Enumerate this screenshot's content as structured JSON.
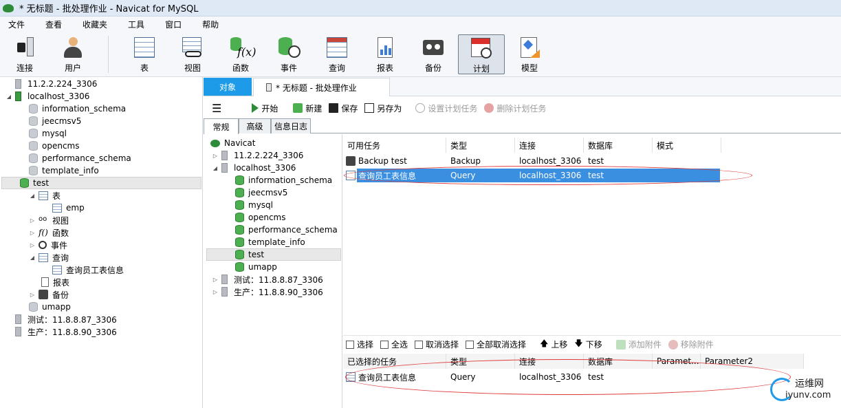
{
  "window": {
    "title": "* 无标题 - 批处理作业 - Navicat for MySQL"
  },
  "menu": [
    "文件",
    "查看",
    "收藏夹",
    "工具",
    "窗口",
    "帮助"
  ],
  "toolbar": {
    "connect": "连接",
    "user": "用户",
    "table": "表",
    "view": "视图",
    "function": "函数",
    "event": "事件",
    "query": "查询",
    "report": "报表",
    "backup": "备份",
    "schedule": "计划",
    "model": "模型"
  },
  "left_tree": {
    "items": [
      {
        "label": "11.2.2.224_3306"
      },
      {
        "label": "localhost_3306"
      },
      {
        "label": "information_schema"
      },
      {
        "label": "jeecmsv5"
      },
      {
        "label": "mysql"
      },
      {
        "label": "opencms"
      },
      {
        "label": "performance_schema"
      },
      {
        "label": "template_info"
      },
      {
        "label": "test"
      },
      {
        "label": "表"
      },
      {
        "label": "emp"
      },
      {
        "label": "视图"
      },
      {
        "label": "函数"
      },
      {
        "label": "事件"
      },
      {
        "label": "查询"
      },
      {
        "label": "查询员工表信息"
      },
      {
        "label": "报表"
      },
      {
        "label": "备份"
      },
      {
        "label": "umapp"
      },
      {
        "label": "测试：11.8.8.87_3306"
      },
      {
        "label": "生产：11.8.8.90_3306"
      }
    ]
  },
  "tabs": {
    "object": "对象",
    "doc": "* 无标题 - 批处理作业"
  },
  "actions": {
    "start": "开始",
    "new": "新建",
    "save": "保存",
    "save_as": "另存为",
    "set_task": "设置计划任务",
    "delete_task": "删除计划任务"
  },
  "subtabs": [
    "常规",
    "高级",
    "信息日志"
  ],
  "mid_tree": {
    "items": [
      {
        "label": "Navicat"
      },
      {
        "label": "11.2.2.224_3306"
      },
      {
        "label": "localhost_3306"
      },
      {
        "label": "information_schema"
      },
      {
        "label": "jeecmsv5"
      },
      {
        "label": "mysql"
      },
      {
        "label": "opencms"
      },
      {
        "label": "performance_schema"
      },
      {
        "label": "template_info"
      },
      {
        "label": "test"
      },
      {
        "label": "umapp"
      },
      {
        "label": "测试：11.8.8.87_3306"
      },
      {
        "label": "生产：11.8.8.90_3306"
      }
    ]
  },
  "available": {
    "headers": [
      "可用任务",
      "类型",
      "连接",
      "数据库",
      "模式"
    ],
    "rows": [
      [
        "Backup test",
        "Backup",
        "localhost_3306",
        "test"
      ],
      [
        "查询员工表信息",
        "Query",
        "localhost_3306",
        "test"
      ]
    ]
  },
  "selection": {
    "select": "选择",
    "select_all": "全选",
    "deselect": "取消选择",
    "deselect_all": "全部取消选择",
    "up": "上移",
    "down": "下移",
    "add_attach": "添加附件",
    "remove_attach": "移除附件"
  },
  "selected": {
    "headers": [
      "已选择的任务",
      "类型",
      "连接",
      "数据库",
      "Paramet...",
      "Parameter2"
    ],
    "rows": [
      [
        "查询员工表信息",
        "Query",
        "localhost_3306",
        "test"
      ]
    ]
  },
  "watermark": {
    "cn": "运维网",
    "url": "iyunv.com"
  }
}
